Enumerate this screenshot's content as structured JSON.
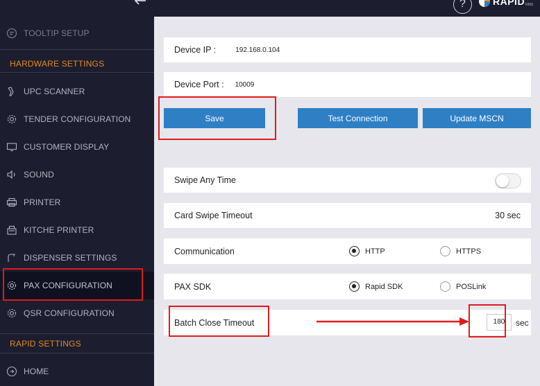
{
  "topbar": {
    "help_label": "?",
    "logo_text": "RAPID",
    "logo_sub": "RMS"
  },
  "sidebar": {
    "items_top": [
      {
        "label": "TOOLTIP SETUP",
        "icon": "tooltip-icon"
      }
    ],
    "hardware_header": "HARDWARE SETTINGS",
    "hardware_items": [
      {
        "label": "UPC SCANNER",
        "icon": "scanner-icon"
      },
      {
        "label": "TENDER CONFIGURATION",
        "icon": "gear-icon"
      },
      {
        "label": "CUSTOMER DISPLAY",
        "icon": "monitor-icon"
      },
      {
        "label": "SOUND",
        "icon": "speaker-icon"
      },
      {
        "label": "PRINTER",
        "icon": "printer-icon"
      },
      {
        "label": "KITCHE PRINTER",
        "icon": "kitchen-printer-icon"
      },
      {
        "label": "DISPENSER SETTINGS",
        "icon": "dispenser-icon"
      },
      {
        "label": "PAX CONFIGURATION",
        "icon": "gear-icon",
        "active": true
      },
      {
        "label": "QSR CONFIGURATION",
        "icon": "gear-icon"
      }
    ],
    "rapid_header": "RAPID SETTINGS",
    "rapid_items": [
      {
        "label": "HOME",
        "icon": "home-icon"
      }
    ]
  },
  "form": {
    "device_ip_label": "Device IP :",
    "device_ip_value": "192.168.0.104",
    "device_port_label": "Device Port :",
    "device_port_value": "10009",
    "save_label": "Save",
    "test_connection_label": "Test Connection",
    "update_mscn_label": "Update MSCN",
    "swipe_any_time_label": "Swipe Any Time",
    "swipe_any_time_on": false,
    "card_swipe_timeout_label": "Card Swipe Timeout",
    "card_swipe_timeout_value": "30 sec",
    "communication_label": "Communication",
    "communication_options": [
      "HTTP",
      "HTTPS"
    ],
    "communication_selected": "HTTP",
    "pax_sdk_label": "PAX SDK",
    "pax_sdk_options": [
      "Rapid SDK",
      "POSLink"
    ],
    "pax_sdk_selected": "Rapid SDK",
    "batch_close_timeout_label": "Batch Close Timeout",
    "batch_close_timeout_value": "180",
    "batch_close_timeout_unit": "sec"
  },
  "colors": {
    "sidebar_bg": "#1c1d2e",
    "accent_orange": "#e28b22",
    "button_blue": "#2f7fc5",
    "annotation_red": "#e01b1b"
  }
}
